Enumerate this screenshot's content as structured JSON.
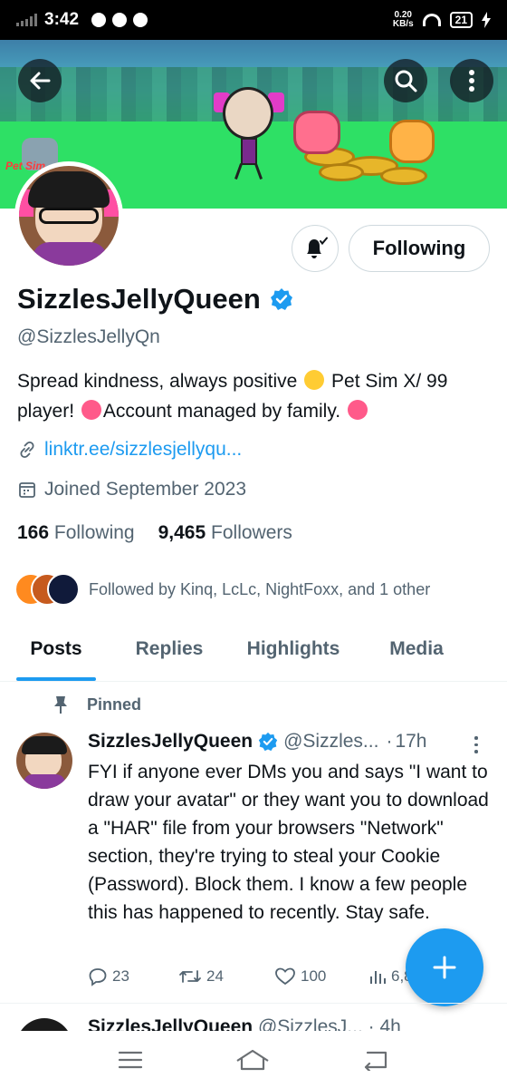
{
  "status_bar": {
    "time": "3:42",
    "net_speed": "0.20",
    "net_unit": "KB/s",
    "battery": "21"
  },
  "header": {
    "back_icon": "arrow-left-icon",
    "search_icon": "search-icon",
    "more_icon": "more-vertical-icon"
  },
  "banner": {
    "game_logo_text": "Pet Sim"
  },
  "profile": {
    "display_name": "SizzlesJellyQueen",
    "verified": true,
    "handle": "@SizzlesJellyQn",
    "bio_part1": "Spread kindness, always positive",
    "bio_part2": "Pet Sim X/ 99 player!",
    "bio_part3": "Account managed by family.",
    "link": "linktr.ee/sizzlesjellyqu...",
    "joined": "Joined September 2023",
    "following_count": "166",
    "following_label": "Following",
    "followers_count": "9,465",
    "followers_label": "Followers",
    "followed_by": "Followed by Kinq, LcLc, NightFoxx, and 1 other",
    "follow_button": "Following"
  },
  "tabs": [
    {
      "label": "Posts",
      "active": true
    },
    {
      "label": "Replies",
      "active": false
    },
    {
      "label": "Highlights",
      "active": false
    },
    {
      "label": "Media",
      "active": false
    }
  ],
  "post": {
    "pinned_label": "Pinned",
    "author": "SizzlesJellyQueen",
    "handle": "@Sizzles...",
    "separator": "·",
    "time": "17h",
    "text": "FYI if anyone ever DMs you and says \"I want to draw your avatar\" or they want you to download a \"HAR\" file from your browsers \"Network\" section, they're trying to steal your Cookie (Password). Block them. I know a few people this has happened to recently. Stay safe.",
    "replies": "23",
    "reposts": "24",
    "likes": "100",
    "views": "6,8"
  },
  "next_post": {
    "author": "SizzlesJellyQueen",
    "handle": "@SizzlesJ...",
    "separator": "·",
    "time": "4h"
  },
  "colors": {
    "accent": "#1d9bf0",
    "text": "#0f1419",
    "muted": "#536471",
    "border": "#cfd9de"
  }
}
